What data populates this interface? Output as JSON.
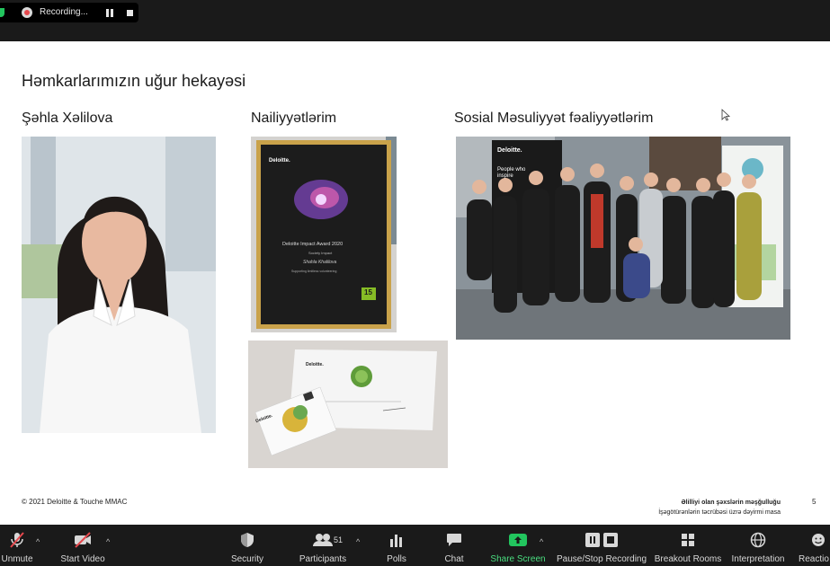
{
  "recording": {
    "label": "Recording..."
  },
  "slide": {
    "title": "Həmkarlarımızın uğur hekayəsi",
    "columns": [
      "Şəhla Xəlilova",
      "Nailiyyətlərim",
      "Sosial Məsuliyyət fəaliyyətlərim"
    ],
    "award": {
      "brand": "Deloitte.",
      "title": "Deloitte Impact Award 2020",
      "subtitle": "Society Impact",
      "name": "Shahla Khalilova",
      "desc": "Supporting limitless volunteering",
      "badge": "15"
    },
    "cards": {
      "brand": "Deloitte.",
      "card_brand": "Deloitte."
    },
    "group": {
      "banner_brand": "Deloitte.",
      "banner_text": "People who inspire"
    },
    "footer": {
      "copyright": "© 2021 Deloitte & Touche MMAC",
      "line1": "Əlilliyi olan şəxslərin məşğulluğu",
      "line2": "İşəgötürənlərin təcrübəsi üzrə dəyirmi masa",
      "page": "5"
    }
  },
  "toolbar": {
    "unmute": "Unmute",
    "start_video": "Start Video",
    "security": "Security",
    "participants": "Participants",
    "participants_count": "51",
    "polls": "Polls",
    "chat": "Chat",
    "share_screen": "Share Screen",
    "pause_stop": "Pause/Stop Recording",
    "breakout": "Breakout Rooms",
    "interpretation": "Interpretation",
    "reactions": "Reactio"
  },
  "colors": {
    "share_green": "#22c55e",
    "mute_red": "#e5484d",
    "award_frame": "#c9a24a",
    "brand_green": "#86bc25"
  }
}
